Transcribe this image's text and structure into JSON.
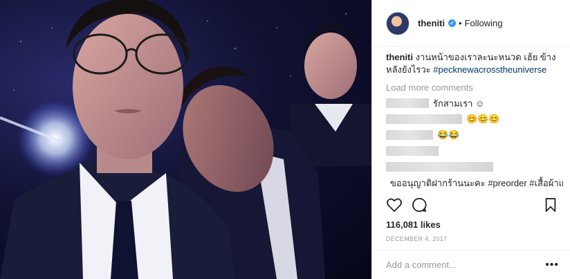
{
  "post": {
    "username": "theniti",
    "follow_separator": "•",
    "follow_status": "Following",
    "verified_glyph": "✓"
  },
  "caption": {
    "username": "theniti",
    "text": "งานหน้าของเราละนะหนวด เฮ้ย ข้างหลังยังไรวะ ",
    "hashtag": "#pecknewacrosstheuniverse"
  },
  "comments": {
    "load_more": "Load more comments",
    "items": [
      {
        "visible_text": "รักสามเรา ☺"
      },
      {
        "visible_text": "😊😊😊"
      },
      {
        "visible_text": "😂😂"
      },
      {
        "visible_text": ""
      },
      {
        "visible_text": ""
      },
      {
        "visible_text": "ขออนุญาติฝากร้านนะคะ #preorder #เสื้อผ้าแฟชั่นเกาหลี"
      }
    ]
  },
  "likes": "116,081 likes",
  "date": "DECEMBER 4, 2017",
  "add_comment": {
    "placeholder": "Add a comment..."
  },
  "more_options": "•••",
  "colors": {
    "link": "#003569",
    "muted": "#999999",
    "verified": "#3897f0"
  },
  "icons": [
    "heart-icon",
    "comment-icon",
    "bookmark-icon",
    "verified-badge-icon"
  ]
}
